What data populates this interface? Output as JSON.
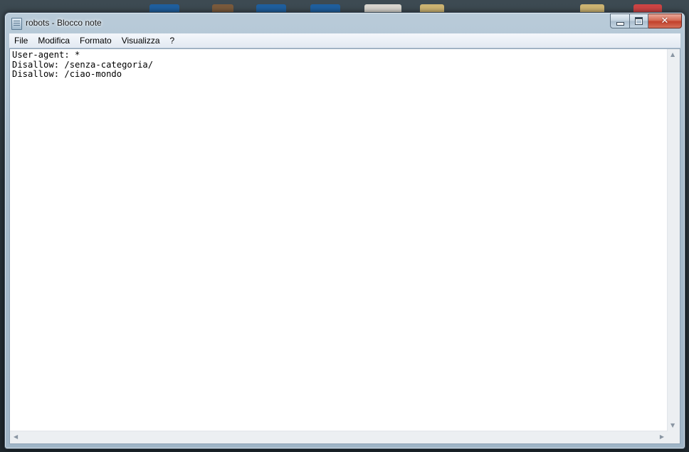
{
  "window": {
    "title": "robots - Blocco note",
    "app_icon": "notepad-icon"
  },
  "caption_buttons": {
    "minimize": "minimize-icon",
    "maximize": "maximize-icon",
    "close_glyph": "✕"
  },
  "menu": {
    "items": [
      {
        "label": "File"
      },
      {
        "label": "Modifica"
      },
      {
        "label": "Formato"
      },
      {
        "label": "Visualizza"
      },
      {
        "label": "?"
      }
    ]
  },
  "document": {
    "lines": [
      "User-agent: *",
      "Disallow: /senza-categoria/",
      "Disallow: /ciao-mondo"
    ]
  },
  "colors": {
    "close_button": "#c2402b",
    "chrome": "#a7bccc",
    "editor_background": "#ffffff"
  }
}
